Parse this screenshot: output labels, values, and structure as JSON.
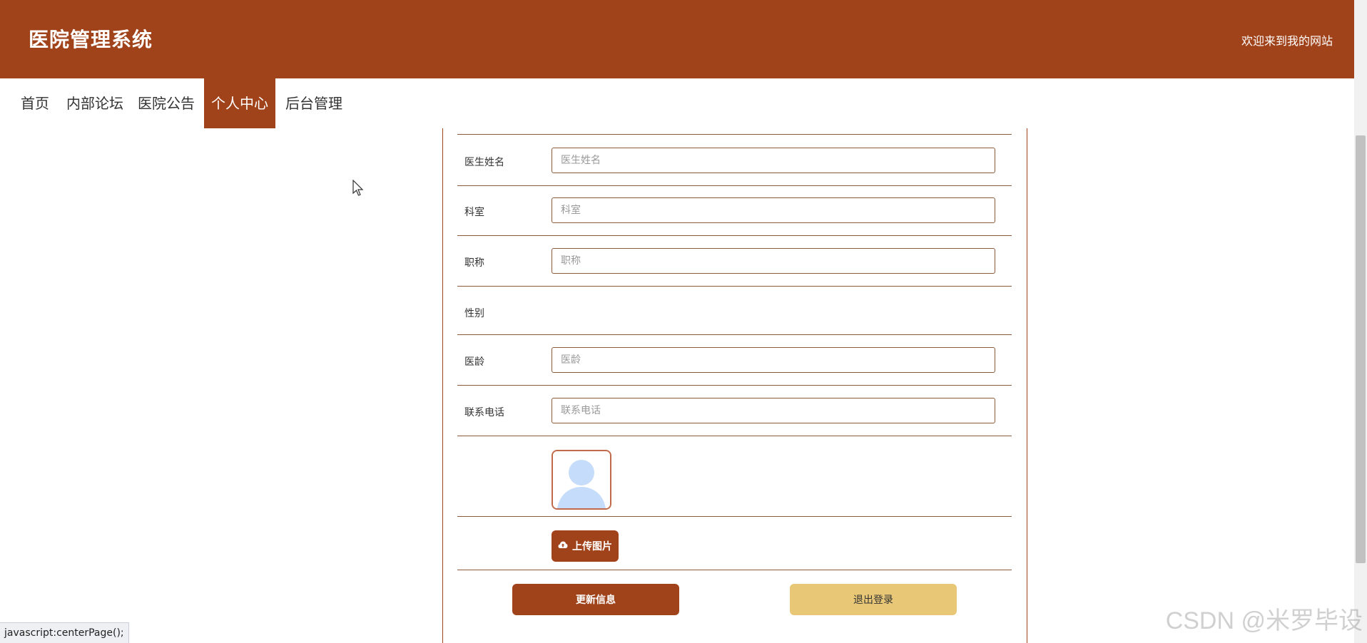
{
  "header": {
    "title": "医院管理系统",
    "welcome": "欢迎来到我的网站"
  },
  "nav": {
    "items": [
      {
        "label": "首页"
      },
      {
        "label": "内部论坛"
      },
      {
        "label": "医院公告"
      },
      {
        "label": "个人中心",
        "active": true
      },
      {
        "label": "后台管理"
      }
    ]
  },
  "form": {
    "doctor_name": {
      "label": "医生姓名",
      "value": "",
      "placeholder": "医生姓名"
    },
    "department": {
      "label": "科室",
      "value": "",
      "placeholder": "科室"
    },
    "title_field": {
      "label": "职称",
      "value": "",
      "placeholder": "职称"
    },
    "gender": {
      "label": "性别"
    },
    "seniority": {
      "label": "医龄",
      "value": "",
      "placeholder": "医龄"
    },
    "phone": {
      "label": "联系电话",
      "value": "",
      "placeholder": "联系电话"
    },
    "upload_label": "上传图片",
    "update_label": "更新信息",
    "logout_label": "退出登录"
  },
  "status_bar": "javascript:centerPage();",
  "watermark": "CSDN @米罗毕设",
  "colors": {
    "brand": "#a1431a",
    "logout": "#e8c877"
  },
  "icons": {
    "upload": "cloud-upload-icon",
    "avatar": "user-avatar-icon",
    "cursor": "mouse-pointer-icon"
  }
}
